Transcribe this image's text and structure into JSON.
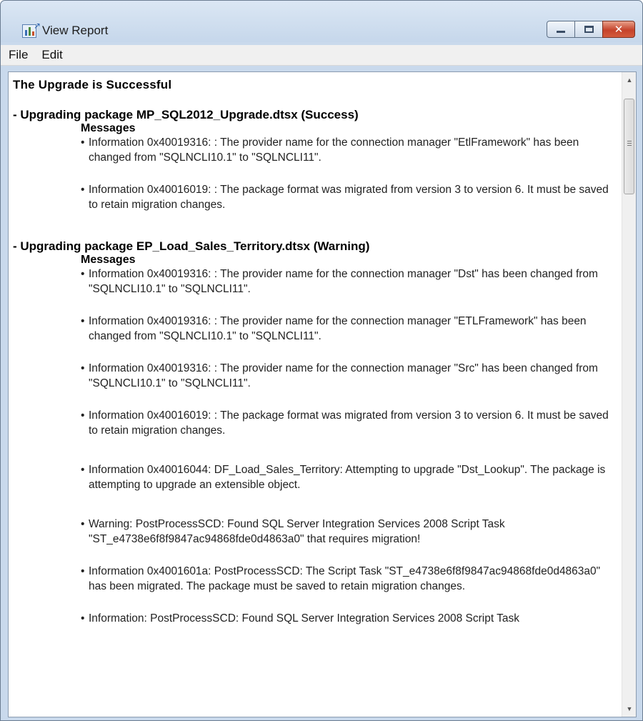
{
  "window": {
    "title": "View Report",
    "controls": {
      "minimize": "",
      "maximize": "",
      "close": "✕"
    }
  },
  "menu": [
    "File",
    "Edit"
  ],
  "report": {
    "title": "The Upgrade is Successful",
    "sections": [
      {
        "header": "- Upgrading package MP_SQL2012_Upgrade.dtsx (Success)",
        "messages_label": "Messages",
        "messages": [
          "Information 0x40019316: : The provider name for the connection manager \"EtlFramework\" has been changed from \"SQLNCLI10.1\" to \"SQLNCLI11\".",
          "Information 0x40016019: : The package format was migrated from version 3 to version 6. It must be saved to retain migration changes."
        ]
      },
      {
        "header": "- Upgrading package EP_Load_Sales_Territory.dtsx (Warning)",
        "messages_label": "Messages",
        "messages": [
          "Information 0x40019316: : The provider name for the connection manager \"Dst\" has been changed from \"SQLNCLI10.1\" to \"SQLNCLI11\".",
          "Information 0x40019316: : The provider name for the connection manager \"ETLFramework\" has been changed from \"SQLNCLI10.1\" to \"SQLNCLI11\".",
          "Information 0x40019316: : The provider name for the connection manager \"Src\" has been changed from \"SQLNCLI10.1\" to \"SQLNCLI11\".",
          "Information 0x40016019: : The package format was migrated from version 3 to version 6. It must be saved to retain migration changes.",
          "Information 0x40016044: DF_Load_Sales_Territory: Attempting to upgrade \"Dst_Lookup\". The package is attempting to upgrade an extensible object.",
          "Warning: PostProcessSCD: Found SQL Server Integration Services 2008 Script Task \"ST_e4738e6f8f9847ac94868fde0d4863a0\" that requires migration!",
          "Information 0x4001601a: PostProcessSCD: The Script Task \"ST_e4738e6f8f9847ac94868fde0d4863a0\" has been migrated. The package must be saved to retain migration changes.",
          "Information: PostProcessSCD: Found SQL Server Integration Services 2008 Script Task"
        ]
      }
    ]
  },
  "scrollbar": {
    "up_arrow": "▲",
    "down_arrow": "▼"
  }
}
